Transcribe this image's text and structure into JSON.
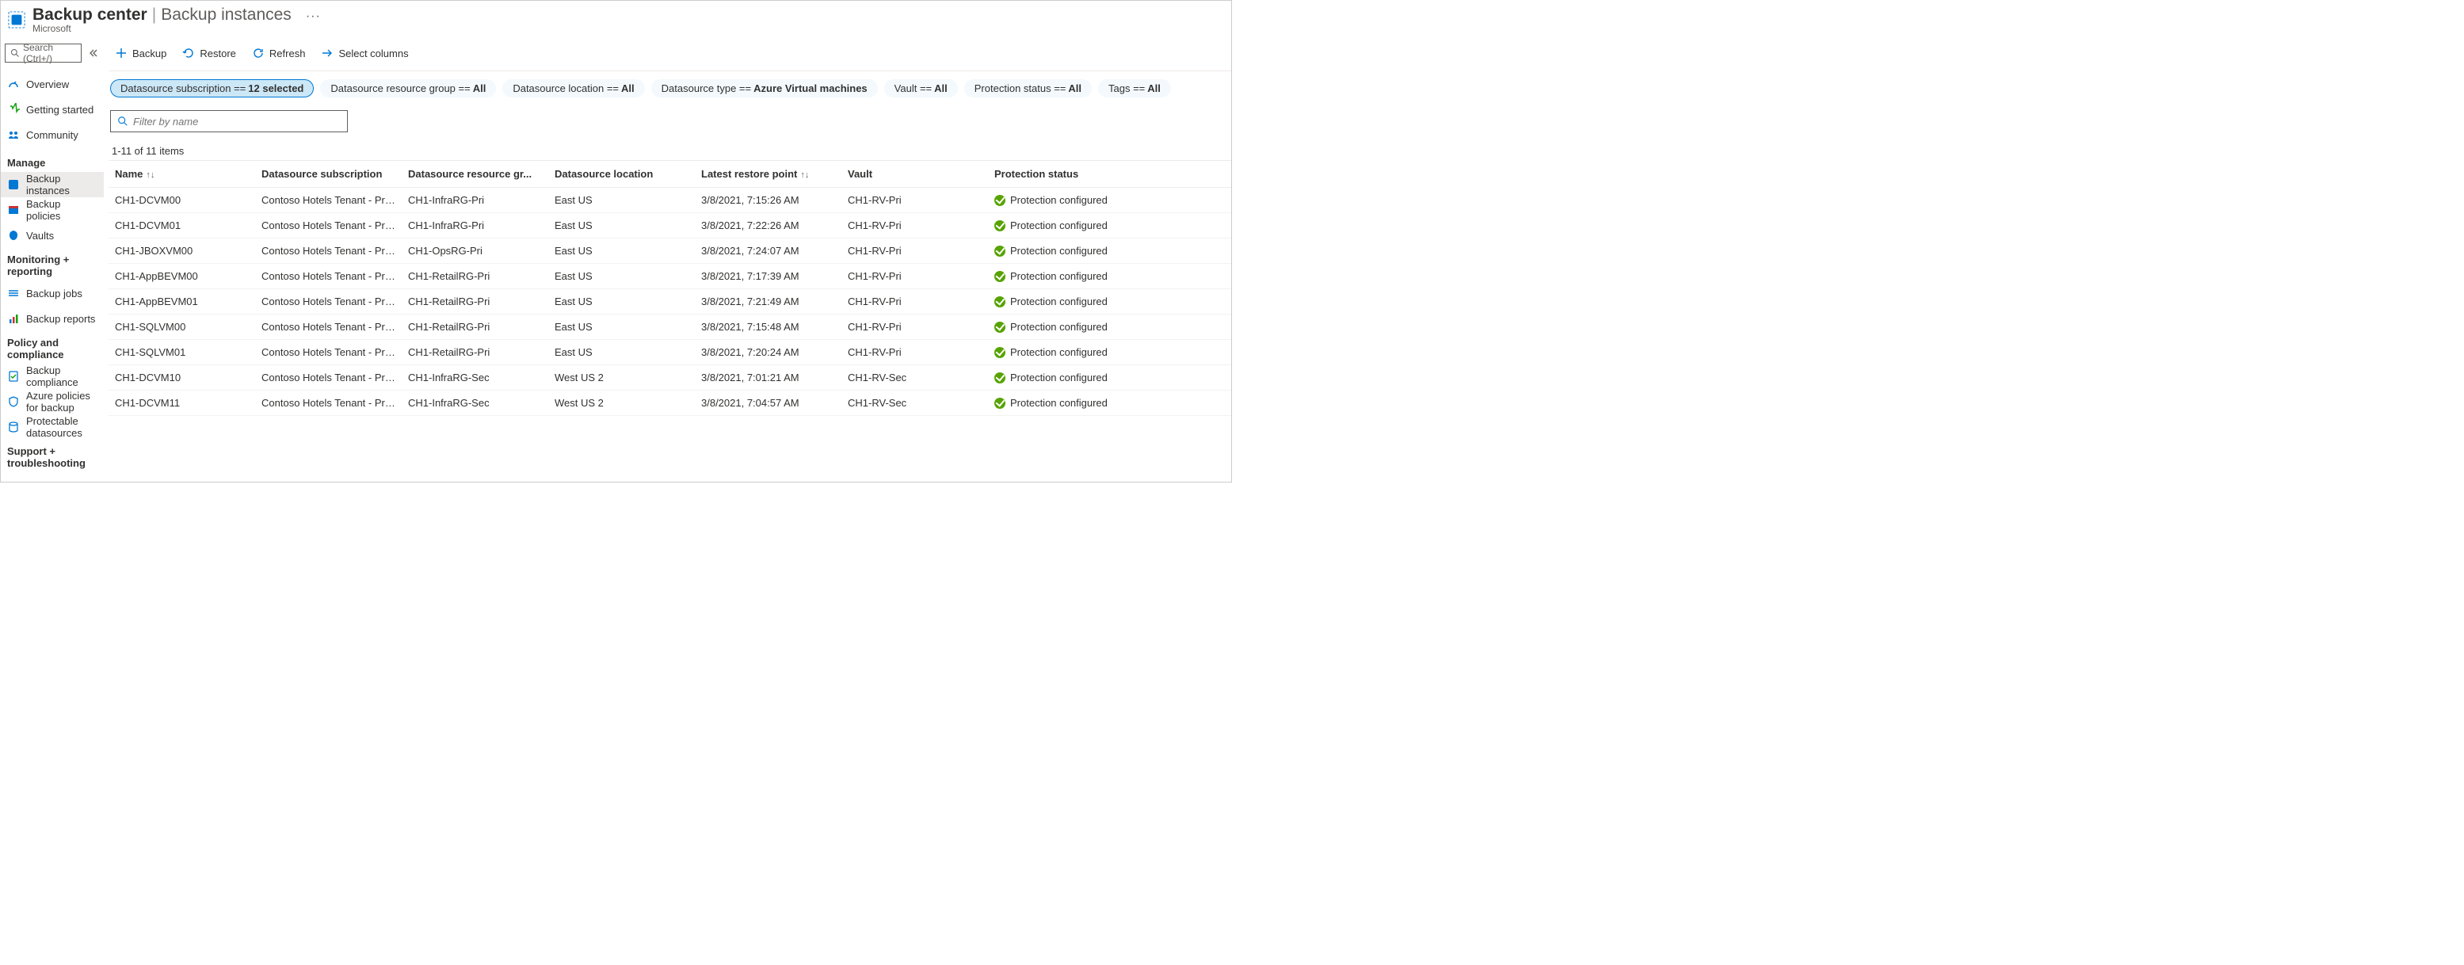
{
  "header": {
    "title_strong": "Backup center",
    "title_separator": "|",
    "title_sub": "Backup instances",
    "org": "Microsoft",
    "ellipsis": "···"
  },
  "search": {
    "placeholder": "Search (Ctrl+/)"
  },
  "nav": {
    "top": [
      {
        "label": "Overview"
      },
      {
        "label": "Getting started"
      },
      {
        "label": "Community"
      }
    ],
    "sections": [
      {
        "header": "Manage",
        "items": [
          {
            "label": "Backup instances",
            "active": true
          },
          {
            "label": "Backup policies"
          },
          {
            "label": "Vaults"
          }
        ]
      },
      {
        "header": "Monitoring + reporting",
        "items": [
          {
            "label": "Backup jobs"
          },
          {
            "label": "Backup reports"
          }
        ]
      },
      {
        "header": "Policy and compliance",
        "items": [
          {
            "label": "Backup compliance"
          },
          {
            "label": "Azure policies for backup"
          },
          {
            "label": "Protectable datasources"
          }
        ]
      },
      {
        "header": "Support + troubleshooting",
        "items": []
      }
    ]
  },
  "toolbar": {
    "backup": "Backup",
    "restore": "Restore",
    "refresh": "Refresh",
    "select_columns": "Select columns"
  },
  "filters": [
    {
      "label": "Datasource subscription == ",
      "value": "12 selected",
      "active": true
    },
    {
      "label": "Datasource resource group == ",
      "value": "All"
    },
    {
      "label": "Datasource location == ",
      "value": "All"
    },
    {
      "label": "Datasource type == ",
      "value": "Azure Virtual machines"
    },
    {
      "label": "Vault == ",
      "value": "All"
    },
    {
      "label": "Protection status == ",
      "value": "All"
    },
    {
      "label": "Tags == ",
      "value": "All"
    }
  ],
  "filter_input": {
    "placeholder": "Filter by name"
  },
  "count_label": "1-11 of 11 items",
  "columns": {
    "name": "Name",
    "subscription": "Datasource subscription",
    "resource_group": "Datasource resource gr...",
    "location": "Datasource location",
    "restore_point": "Latest restore point",
    "vault": "Vault",
    "status": "Protection status"
  },
  "rows": [
    {
      "name": "CH1-DCVM00",
      "sub": "Contoso Hotels Tenant - Pro...",
      "rg": "CH1-InfraRG-Pri",
      "loc": "East US",
      "restore": "3/8/2021, 7:15:26 AM",
      "vault": "CH1-RV-Pri",
      "status": "Protection configured"
    },
    {
      "name": "CH1-DCVM01",
      "sub": "Contoso Hotels Tenant - Pro...",
      "rg": "CH1-InfraRG-Pri",
      "loc": "East US",
      "restore": "3/8/2021, 7:22:26 AM",
      "vault": "CH1-RV-Pri",
      "status": "Protection configured"
    },
    {
      "name": "CH1-JBOXVM00",
      "sub": "Contoso Hotels Tenant - Pro...",
      "rg": "CH1-OpsRG-Pri",
      "loc": "East US",
      "restore": "3/8/2021, 7:24:07 AM",
      "vault": "CH1-RV-Pri",
      "status": "Protection configured"
    },
    {
      "name": "CH1-AppBEVM00",
      "sub": "Contoso Hotels Tenant - Pro...",
      "rg": "CH1-RetailRG-Pri",
      "loc": "East US",
      "restore": "3/8/2021, 7:17:39 AM",
      "vault": "CH1-RV-Pri",
      "status": "Protection configured"
    },
    {
      "name": "CH1-AppBEVM01",
      "sub": "Contoso Hotels Tenant - Pro...",
      "rg": "CH1-RetailRG-Pri",
      "loc": "East US",
      "restore": "3/8/2021, 7:21:49 AM",
      "vault": "CH1-RV-Pri",
      "status": "Protection configured"
    },
    {
      "name": "CH1-SQLVM00",
      "sub": "Contoso Hotels Tenant - Pro...",
      "rg": "CH1-RetailRG-Pri",
      "loc": "East US",
      "restore": "3/8/2021, 7:15:48 AM",
      "vault": "CH1-RV-Pri",
      "status": "Protection configured"
    },
    {
      "name": "CH1-SQLVM01",
      "sub": "Contoso Hotels Tenant - Pro...",
      "rg": "CH1-RetailRG-Pri",
      "loc": "East US",
      "restore": "3/8/2021, 7:20:24 AM",
      "vault": "CH1-RV-Pri",
      "status": "Protection configured"
    },
    {
      "name": "CH1-DCVM10",
      "sub": "Contoso Hotels Tenant - Pro...",
      "rg": "CH1-InfraRG-Sec",
      "loc": "West US 2",
      "restore": "3/8/2021, 7:01:21 AM",
      "vault": "CH1-RV-Sec",
      "status": "Protection configured"
    },
    {
      "name": "CH1-DCVM11",
      "sub": "Contoso Hotels Tenant - Pro...",
      "rg": "CH1-InfraRG-Sec",
      "loc": "West US 2",
      "restore": "3/8/2021, 7:04:57 AM",
      "vault": "CH1-RV-Sec",
      "status": "Protection configured"
    }
  ]
}
